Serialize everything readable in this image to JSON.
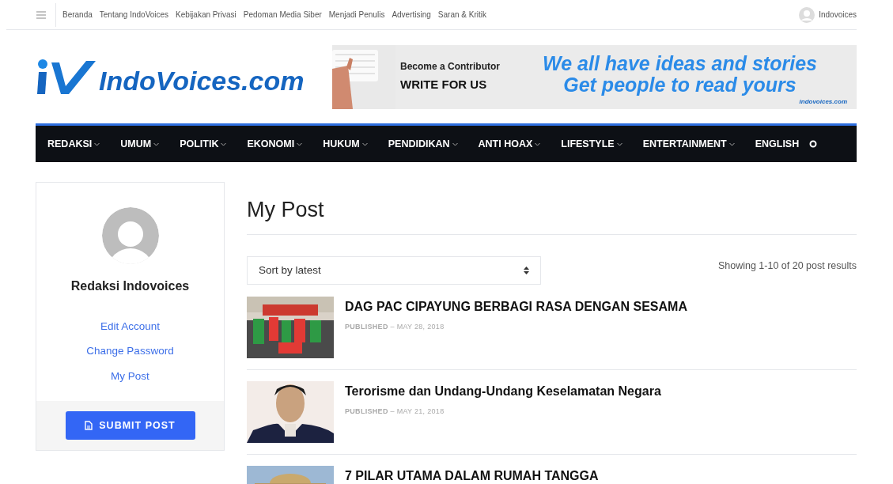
{
  "top_bar": {
    "links": [
      "Beranda",
      "Tentang IndoVoices",
      "Kebijakan Privasi",
      "Pedoman Media Siber",
      "Menjadi Penulis",
      "Advertising",
      "Saran & Kritik"
    ],
    "user": "Indovoices"
  },
  "logo": {
    "text": "IndoVoices.com"
  },
  "banner": {
    "kicker": "Become a Contributor",
    "cta": "WRITE FOR US",
    "headline_1": "We all have ideas and stories",
    "headline_2": "Get people to read yours",
    "brand": "indovoices.com"
  },
  "nav": {
    "items": [
      {
        "label": "REDAKSI",
        "dropdown": true
      },
      {
        "label": "UMUM",
        "dropdown": true
      },
      {
        "label": "POLITIK",
        "dropdown": true
      },
      {
        "label": "EKONOMI",
        "dropdown": true
      },
      {
        "label": "HUKUM",
        "dropdown": true
      },
      {
        "label": "PENDIDIKAN",
        "dropdown": true
      },
      {
        "label": "ANTI HOAX",
        "dropdown": true
      },
      {
        "label": "LIFESTYLE",
        "dropdown": true
      },
      {
        "label": "ENTERTAINMENT",
        "dropdown": true
      },
      {
        "label": "ENGLISH",
        "dropdown": false
      }
    ]
  },
  "sidebar": {
    "name": "Redaksi Indovoices",
    "links": [
      "Edit Account",
      "Change Password",
      "My Post"
    ],
    "button": "SUBMIT POST"
  },
  "main": {
    "title": "My Post",
    "sort": "Sort by latest",
    "results": "Showing 1-10 of 20 post results",
    "posts": [
      {
        "title": "DAG PAC CIPAYUNG BERBAGI RASA DENGAN SESAMA",
        "label": "PUBLISHED",
        "date": "– MAY 28, 2018"
      },
      {
        "title": "Terorisme dan Undang-Undang Keselamatan Negara",
        "label": "PUBLISHED",
        "date": "– MAY 21, 2018"
      },
      {
        "title": "7 PILAR UTAMA DALAM RUMAH TANGGA"
      }
    ]
  }
}
